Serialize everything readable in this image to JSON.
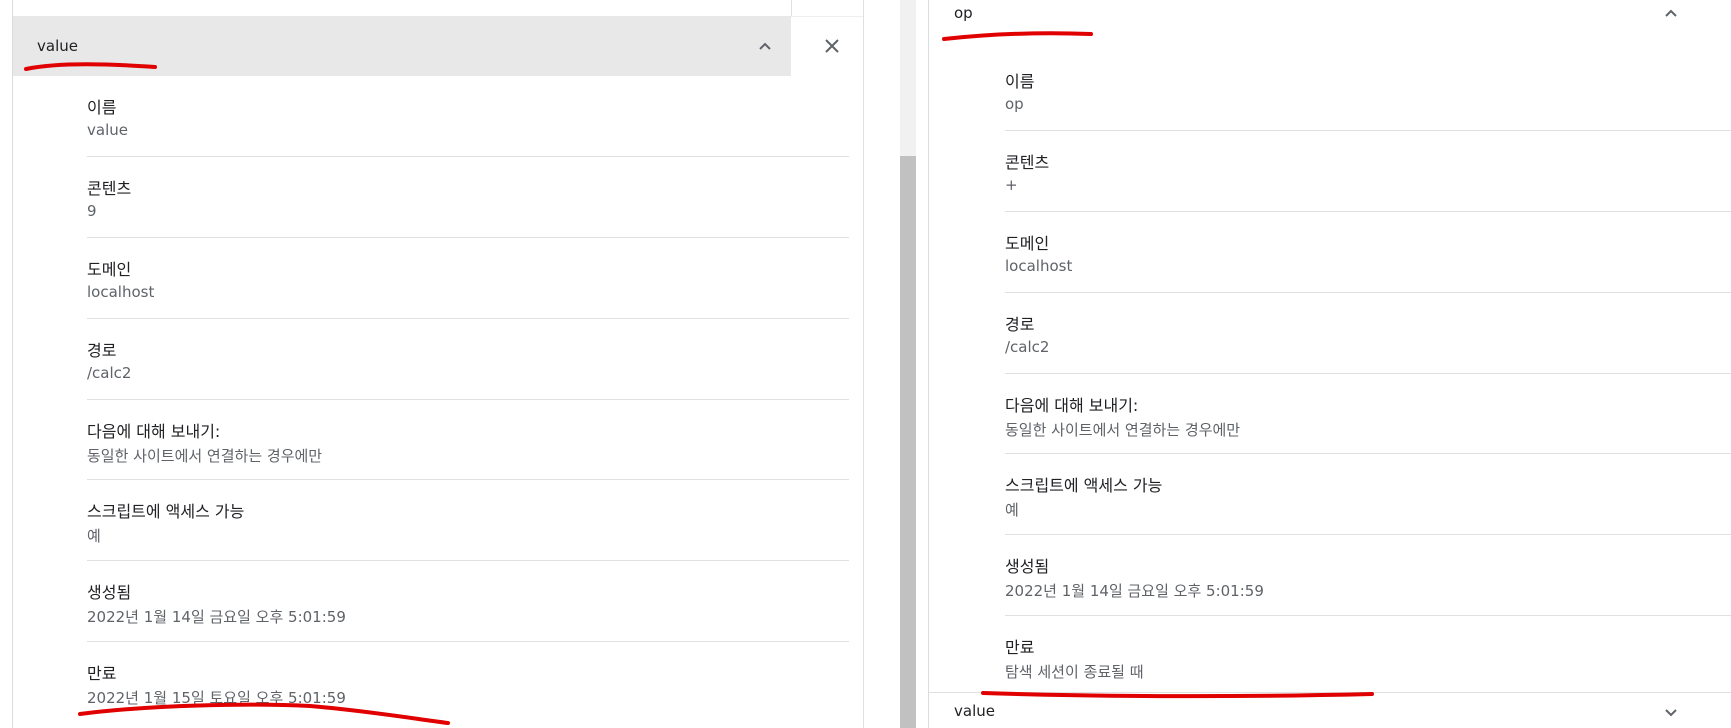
{
  "left": {
    "header_name": "value",
    "fields": [
      {
        "label": "이름",
        "value": "value"
      },
      {
        "label": "콘텐츠",
        "value": "9"
      },
      {
        "label": "도메인",
        "value": "localhost"
      },
      {
        "label": "경로",
        "value": "/calc2"
      },
      {
        "label": "다음에 대해 보내기:",
        "value": "동일한 사이트에서 연결하는 경우에만"
      },
      {
        "label": "스크립트에 액세스 가능",
        "value": "예"
      },
      {
        "label": "생성됨",
        "value": "2022년 1월 14일 금요일 오후 5:01:59"
      },
      {
        "label": "만료",
        "value": "2022년 1월 15일 토요일 오후 5:01:59"
      }
    ]
  },
  "right": {
    "header_name": "op",
    "fields": [
      {
        "label": "이름",
        "value": "op"
      },
      {
        "label": "콘텐츠",
        "value": "+"
      },
      {
        "label": "도메인",
        "value": "localhost"
      },
      {
        "label": "경로",
        "value": "/calc2"
      },
      {
        "label": "다음에 대해 보내기:",
        "value": "동일한 사이트에서 연결하는 경우에만"
      },
      {
        "label": "스크립트에 액세스 가능",
        "value": "예"
      },
      {
        "label": "생성됨",
        "value": "2022년 1월 14일 금요일 오후 5:01:59"
      },
      {
        "label": "만료",
        "value": "탐색 세션이 종료될 때"
      }
    ],
    "next_header_name": "value"
  },
  "colors": {
    "annotation_red": "#e00000",
    "header_bg": "#e8e8e8"
  },
  "icons": {
    "expand": "chevron-up-icon",
    "collapse": "chevron-down-icon",
    "close": "close-icon"
  }
}
